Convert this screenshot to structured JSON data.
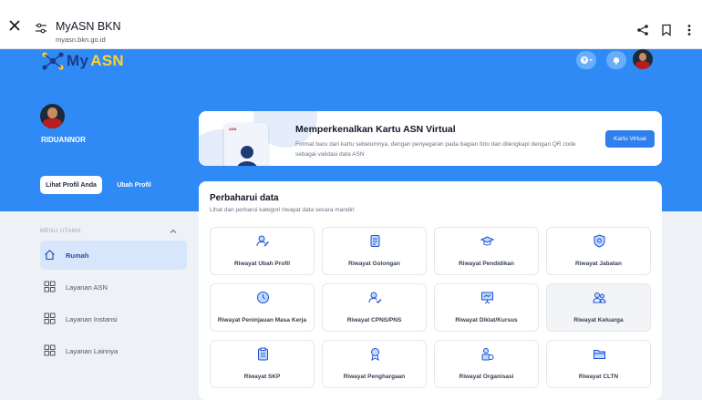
{
  "browser": {
    "title": "MyASN BKN",
    "url": "myasn.bkn.go.id",
    "icons": [
      "close-icon",
      "site-settings-icon",
      "share-icon",
      "bookmark-icon",
      "more-vert-icon"
    ]
  },
  "header": {
    "logo_my": "My",
    "logo_asn": "ASN",
    "icons": [
      "help-icon",
      "bell-icon"
    ]
  },
  "profile": {
    "name": "RIDUANNOR",
    "lihat_label": "Lihat Profil Anda",
    "ubah_label": "Ubah Profil"
  },
  "sidebar": {
    "heading": "MENU UTAMA",
    "items": [
      {
        "label": "Rumah",
        "icon": "home-icon",
        "active": true
      },
      {
        "label": "Layanan ASN",
        "icon": "grid-icon",
        "active": false
      },
      {
        "label": "Layanan Instansi",
        "icon": "grid-icon",
        "active": false
      },
      {
        "label": "Layanan Lainnya",
        "icon": "grid-icon",
        "active": false
      }
    ]
  },
  "banner": {
    "card_tag": "ASN",
    "title": "Memperkenalkan Kartu ASN Virtual",
    "desc": "Format baru dari kartu sebelumnya, dengan penyegaran pada bagian foto dan dilengkapi dengan QR code sebagai validasi data ASN",
    "button": "Kartu Virtual"
  },
  "update": {
    "title": "Perbaharui data",
    "desc": "Lihat dan perbarui kategori riwayat data secara mandiri",
    "tiles": [
      {
        "label": "Riwayat Ubah Profil",
        "icon": "user-edit-icon"
      },
      {
        "label": "Riwayat Golongan",
        "icon": "document-icon"
      },
      {
        "label": "Riwayat Pendidikan",
        "icon": "graduation-cap-icon"
      },
      {
        "label": "Riwayat Jabatan",
        "icon": "badge-icon"
      },
      {
        "label": "Riwayat Peninjauan Masa Kerja",
        "icon": "clock-icon"
      },
      {
        "label": "Riwayat CPNS/PNS",
        "icon": "user-check-icon"
      },
      {
        "label": "Riwayat Diklat/Kursus",
        "icon": "presentation-icon"
      },
      {
        "label": "Riwayat Keluarga",
        "icon": "family-icon"
      },
      {
        "label": "Riwayat SKP",
        "icon": "clipboard-icon"
      },
      {
        "label": "Riwayat Penghargaan",
        "icon": "award-icon"
      },
      {
        "label": "Riwayat Organisasi",
        "icon": "organization-icon"
      },
      {
        "label": "Riwayat CLTN",
        "icon": "folder-icon"
      }
    ]
  },
  "colors": {
    "hero": "#2f8af5",
    "accent": "#2f80ed",
    "logo_yellow": "#ffd22e",
    "active_menu": "#d8e6fb",
    "icon_blue": "#1d4ed8"
  }
}
